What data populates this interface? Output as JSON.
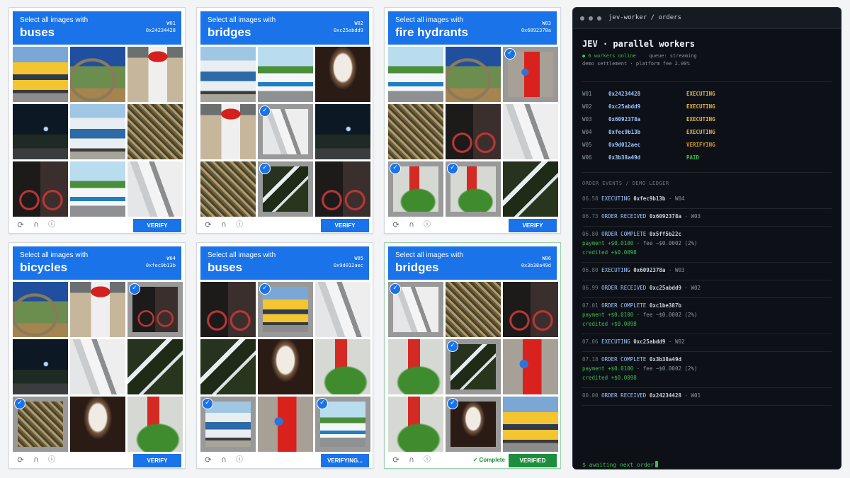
{
  "captchas": [
    {
      "worker": "W01",
      "addr": "0x24234428",
      "instruction": "Select all images with",
      "target": "buses",
      "button": "VERIFY",
      "status": "",
      "tiles": [
        {
          "art": "bus-yellow",
          "sel": false
        },
        {
          "art": "bridge-arch",
          "sel": false
        },
        {
          "art": "hydrant-white",
          "sel": false
        },
        {
          "art": "night",
          "sel": false
        },
        {
          "art": "bus-blue",
          "sel": false
        },
        {
          "art": "bike-pile",
          "sel": false
        },
        {
          "art": "bike-dark",
          "sel": false
        },
        {
          "art": "bus-white",
          "sel": false
        },
        {
          "art": "bridge-white",
          "sel": false
        }
      ]
    },
    {
      "worker": "W02",
      "addr": "0xc25abdd9",
      "instruction": "Select all images with",
      "target": "bridges",
      "button": "VERIFY",
      "status": "",
      "tiles": [
        {
          "art": "bus-blue",
          "sel": false
        },
        {
          "art": "bus-white",
          "sel": false
        },
        {
          "art": "bridge-tunnel",
          "sel": false
        },
        {
          "art": "hydrant-white",
          "sel": false
        },
        {
          "art": "bridge-white",
          "sel": true
        },
        {
          "art": "night",
          "sel": false
        },
        {
          "art": "bike-pile",
          "sel": false
        },
        {
          "art": "bridge-rail",
          "sel": true
        },
        {
          "art": "bike-dark",
          "sel": false
        }
      ]
    },
    {
      "worker": "W03",
      "addr": "0x6092378a",
      "instruction": "Select all images with",
      "target": "fire hydrants",
      "button": "VERIFY",
      "status": "",
      "tiles": [
        {
          "art": "bus-white",
          "sel": false
        },
        {
          "art": "bridge-arch",
          "sel": false
        },
        {
          "art": "hydrant-red",
          "sel": true
        },
        {
          "art": "bike-pile",
          "sel": false
        },
        {
          "art": "bike-dark",
          "sel": false
        },
        {
          "art": "bridge-white",
          "sel": false
        },
        {
          "art": "hydrant-plant",
          "sel": true
        },
        {
          "art": "hydrant-plant",
          "sel": true
        },
        {
          "art": "bridge-rail",
          "sel": false
        }
      ]
    },
    {
      "worker": "W04",
      "addr": "0xfec9b13b",
      "instruction": "Select all images with",
      "target": "bicycles",
      "button": "VERIFY",
      "status": "",
      "tiles": [
        {
          "art": "bridge-arch",
          "sel": false
        },
        {
          "art": "hydrant-white",
          "sel": false
        },
        {
          "art": "bike-dark",
          "sel": true
        },
        {
          "art": "night",
          "sel": false
        },
        {
          "art": "bridge-white",
          "sel": false
        },
        {
          "art": "bridge-rail",
          "sel": false
        },
        {
          "art": "bike-pile",
          "sel": true
        },
        {
          "art": "bridge-tunnel",
          "sel": false
        },
        {
          "art": "hydrant-plant",
          "sel": false
        }
      ]
    },
    {
      "worker": "W05",
      "addr": "0x9d012aec",
      "instruction": "Select all images with",
      "target": "buses",
      "button": "VERIFYING...",
      "status": "",
      "tiles": [
        {
          "art": "bike-dark",
          "sel": false
        },
        {
          "art": "bus-yellow",
          "sel": true
        },
        {
          "art": "bridge-white",
          "sel": false
        },
        {
          "art": "bridge-rail",
          "sel": false
        },
        {
          "art": "bridge-tunnel",
          "sel": false
        },
        {
          "art": "hydrant-plant",
          "sel": false
        },
        {
          "art": "bus-blue",
          "sel": true
        },
        {
          "art": "hydrant-red",
          "sel": false
        },
        {
          "art": "bus-white",
          "sel": true
        }
      ]
    },
    {
      "worker": "W06",
      "addr": "0x3b38a49d",
      "instruction": "Select all images with",
      "target": "bridges",
      "button": "VERIFIED",
      "status": "✓ Complete",
      "tiles": [
        {
          "art": "bridge-white",
          "sel": true
        },
        {
          "art": "bike-pile",
          "sel": false
        },
        {
          "art": "bike-dark",
          "sel": false
        },
        {
          "art": "hydrant-plant",
          "sel": false
        },
        {
          "art": "bridge-rail",
          "sel": true
        },
        {
          "art": "hydrant-red",
          "sel": false
        },
        {
          "art": "hydrant-plant",
          "sel": false
        },
        {
          "art": "bridge-tunnel",
          "sel": true
        },
        {
          "art": "bus-yellow",
          "sel": false
        }
      ]
    }
  ],
  "terminal": {
    "title": "jev-worker / orders",
    "heading": "JEV · parallel workers",
    "online": "● 6 workers online",
    "queue": "queue: streaming",
    "settlement": "demo settlement · platform fee 2.00%",
    "workers": [
      {
        "id": "W01",
        "addr": "0x24234428",
        "status": "EXECUTING",
        "cls": "st-exec"
      },
      {
        "id": "W02",
        "addr": "0xc25abdd9",
        "status": "EXECUTING",
        "cls": "st-exec"
      },
      {
        "id": "W03",
        "addr": "0x6092378a",
        "status": "EXECUTING",
        "cls": "st-exec"
      },
      {
        "id": "W04",
        "addr": "0xfec9b13b",
        "status": "EXECUTING",
        "cls": "st-exec"
      },
      {
        "id": "W05",
        "addr": "0x9d012aec",
        "status": "VERIFYING",
        "cls": "st-ver"
      },
      {
        "id": "W06",
        "addr": "0x3b38a49d",
        "status": "PAID",
        "cls": "st-paid"
      }
    ],
    "events_title": "ORDER EVENTS / DEMO LEDGER",
    "events": [
      {
        "time": "06.58",
        "kind": "EXECUTING",
        "addr": "0xfec9b13b",
        "wk": "· W04"
      },
      {
        "time": "06.73",
        "kind": "ORDER RECEIVED",
        "addr": "0x6092378a",
        "wk": "· W03"
      },
      {
        "time": "06.80",
        "kind": "ORDER COMPLETE",
        "addr": "0x5ff5b22c",
        "wk": "",
        "pay": "payment +$0.0100",
        "fee": "· fee −$0.0002 (2%)",
        "credit": "credited +$0.0098"
      },
      {
        "time": "06.80",
        "kind": "EXECUTING",
        "addr": "0x6092378a",
        "wk": "· W03"
      },
      {
        "time": "06.99",
        "kind": "ORDER RECEIVED",
        "addr": "0xc25abdd9",
        "wk": "· W02"
      },
      {
        "time": "07.01",
        "kind": "ORDER COMPLETE",
        "addr": "0xc1be387b",
        "wk": "",
        "pay": "payment +$0.0100",
        "fee": "· fee −$0.0002 (2%)",
        "credit": "credited +$0.0098"
      },
      {
        "time": "07.06",
        "kind": "EXECUTING",
        "addr": "0xc25abdd9",
        "wk": "· W02"
      },
      {
        "time": "07.18",
        "kind": "ORDER COMPLETE",
        "addr": "0x3b38a49d",
        "wk": "",
        "pay": "payment +$0.0100",
        "fee": "· fee −$0.0002 (2%)",
        "credit": "credited +$0.0098"
      },
      {
        "time": "00.00",
        "kind": "ORDER RECEIVED",
        "addr": "0x24234428",
        "wk": "· W01"
      }
    ],
    "prompt": "$ awaiting next order"
  },
  "icons": {
    "reload": "reload-icon",
    "audio": "headphones-icon",
    "info": "info-icon",
    "check": "checkmark-icon"
  },
  "colors": {
    "accent": "#1a73e8",
    "success": "#1e8e3e",
    "terminal_bg": "#0d1117",
    "executing": "#e3b341",
    "paid": "#3fb950"
  }
}
